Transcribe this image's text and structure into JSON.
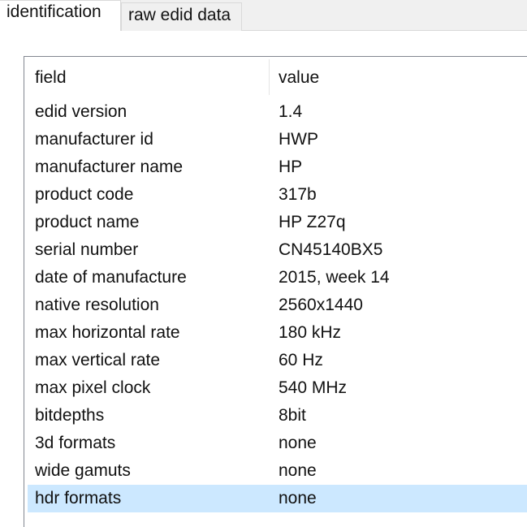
{
  "tabs": [
    {
      "label": "identification",
      "active": true
    },
    {
      "label": "raw edid data",
      "active": false
    }
  ],
  "table": {
    "columns": [
      "field",
      "value"
    ],
    "rows": [
      {
        "field": "edid version",
        "value": "1.4"
      },
      {
        "field": "manufacturer id",
        "value": "HWP"
      },
      {
        "field": "manufacturer name",
        "value": "HP"
      },
      {
        "field": "product code",
        "value": "317b"
      },
      {
        "field": "product name",
        "value": "HP Z27q"
      },
      {
        "field": "serial number",
        "value": "CN45140BX5"
      },
      {
        "field": "date of manufacture",
        "value": "2015, week 14"
      },
      {
        "field": "native resolution",
        "value": "2560x1440"
      },
      {
        "field": "max horizontal rate",
        "value": "180 kHz"
      },
      {
        "field": "max vertical rate",
        "value": "60 Hz"
      },
      {
        "field": "max pixel clock",
        "value": "540 MHz"
      },
      {
        "field": "bitdepths",
        "value": "8bit"
      },
      {
        "field": "3d formats",
        "value": "none"
      },
      {
        "field": "wide gamuts",
        "value": "none"
      },
      {
        "field": "hdr formats",
        "value": "none"
      }
    ],
    "selected_row": 14
  },
  "colors": {
    "selection": "#cce8ff",
    "window_bg": "#f0f0f0",
    "border": "#828790"
  }
}
